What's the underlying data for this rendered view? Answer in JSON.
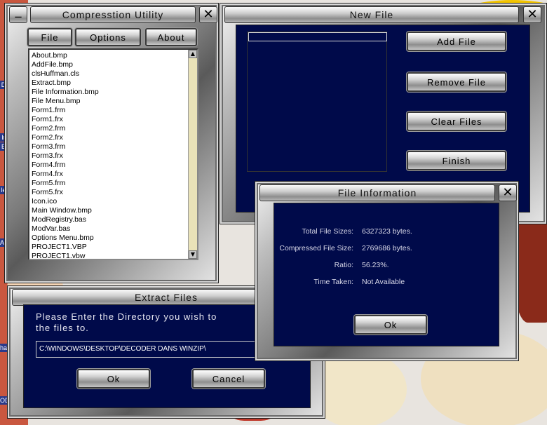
{
  "compression_utility": {
    "title": "Compresstion Utility",
    "minimize_symbol": "_",
    "close_symbol": "✕",
    "menu": [
      {
        "label": "File"
      },
      {
        "label": "Options"
      },
      {
        "label": "About"
      }
    ],
    "files": [
      "About.bmp",
      "AddFile.bmp",
      "clsHuffman.cls",
      "Extract.bmp",
      "File Information.bmp",
      "File Menu.bmp",
      "Form1.frm",
      "Form1.frx",
      "Form2.frm",
      "Form2.frx",
      "Form3.frm",
      "Form3.frx",
      "Form4.frm",
      "Form4.frx",
      "Form5.frm",
      "Form5.frx",
      "Icon.ico",
      "Main Window.bmp",
      "ModRegistry.bas",
      "ModVar.bas",
      "Options Menu.bmp",
      "PROJECT1.VBP",
      "PROJECT1.vbw"
    ],
    "scroll_up": "▲",
    "scroll_down": "▼"
  },
  "new_file": {
    "title": "New File",
    "close_symbol": "✕",
    "input_value": "",
    "buttons": {
      "add": "Add File",
      "remove": "Remove File",
      "clear": "Clear Files",
      "finish": "Finish"
    }
  },
  "file_information": {
    "title": "File Information",
    "close_symbol": "✕",
    "rows": [
      {
        "label": "Total File Sizes:",
        "value": "6327323 bytes."
      },
      {
        "label": "Compressed File Size:",
        "value": "2769686 bytes."
      },
      {
        "label": "Ratio:",
        "value": "56.23%."
      },
      {
        "label": "Time Taken:",
        "value": "Not Available"
      }
    ],
    "ok": "Ok"
  },
  "extract_files": {
    "title": "Extract Files",
    "prompt_line1": "Please Enter the Directory you wish to",
    "prompt_line2": "the files to.",
    "path_value": "C:\\WINDOWS\\DESKTOP\\DECODER DANS WINZIP\\",
    "ok": "Ok",
    "cancel": "Cancel"
  },
  "desktop_labels": [
    "D",
    "Ir",
    "E",
    "le",
    "As",
    "ha",
    "OD"
  ],
  "colors": {
    "navy": "#000a4a",
    "list_bg": "#ffffff",
    "scroll_track": "#e9e2b8"
  }
}
